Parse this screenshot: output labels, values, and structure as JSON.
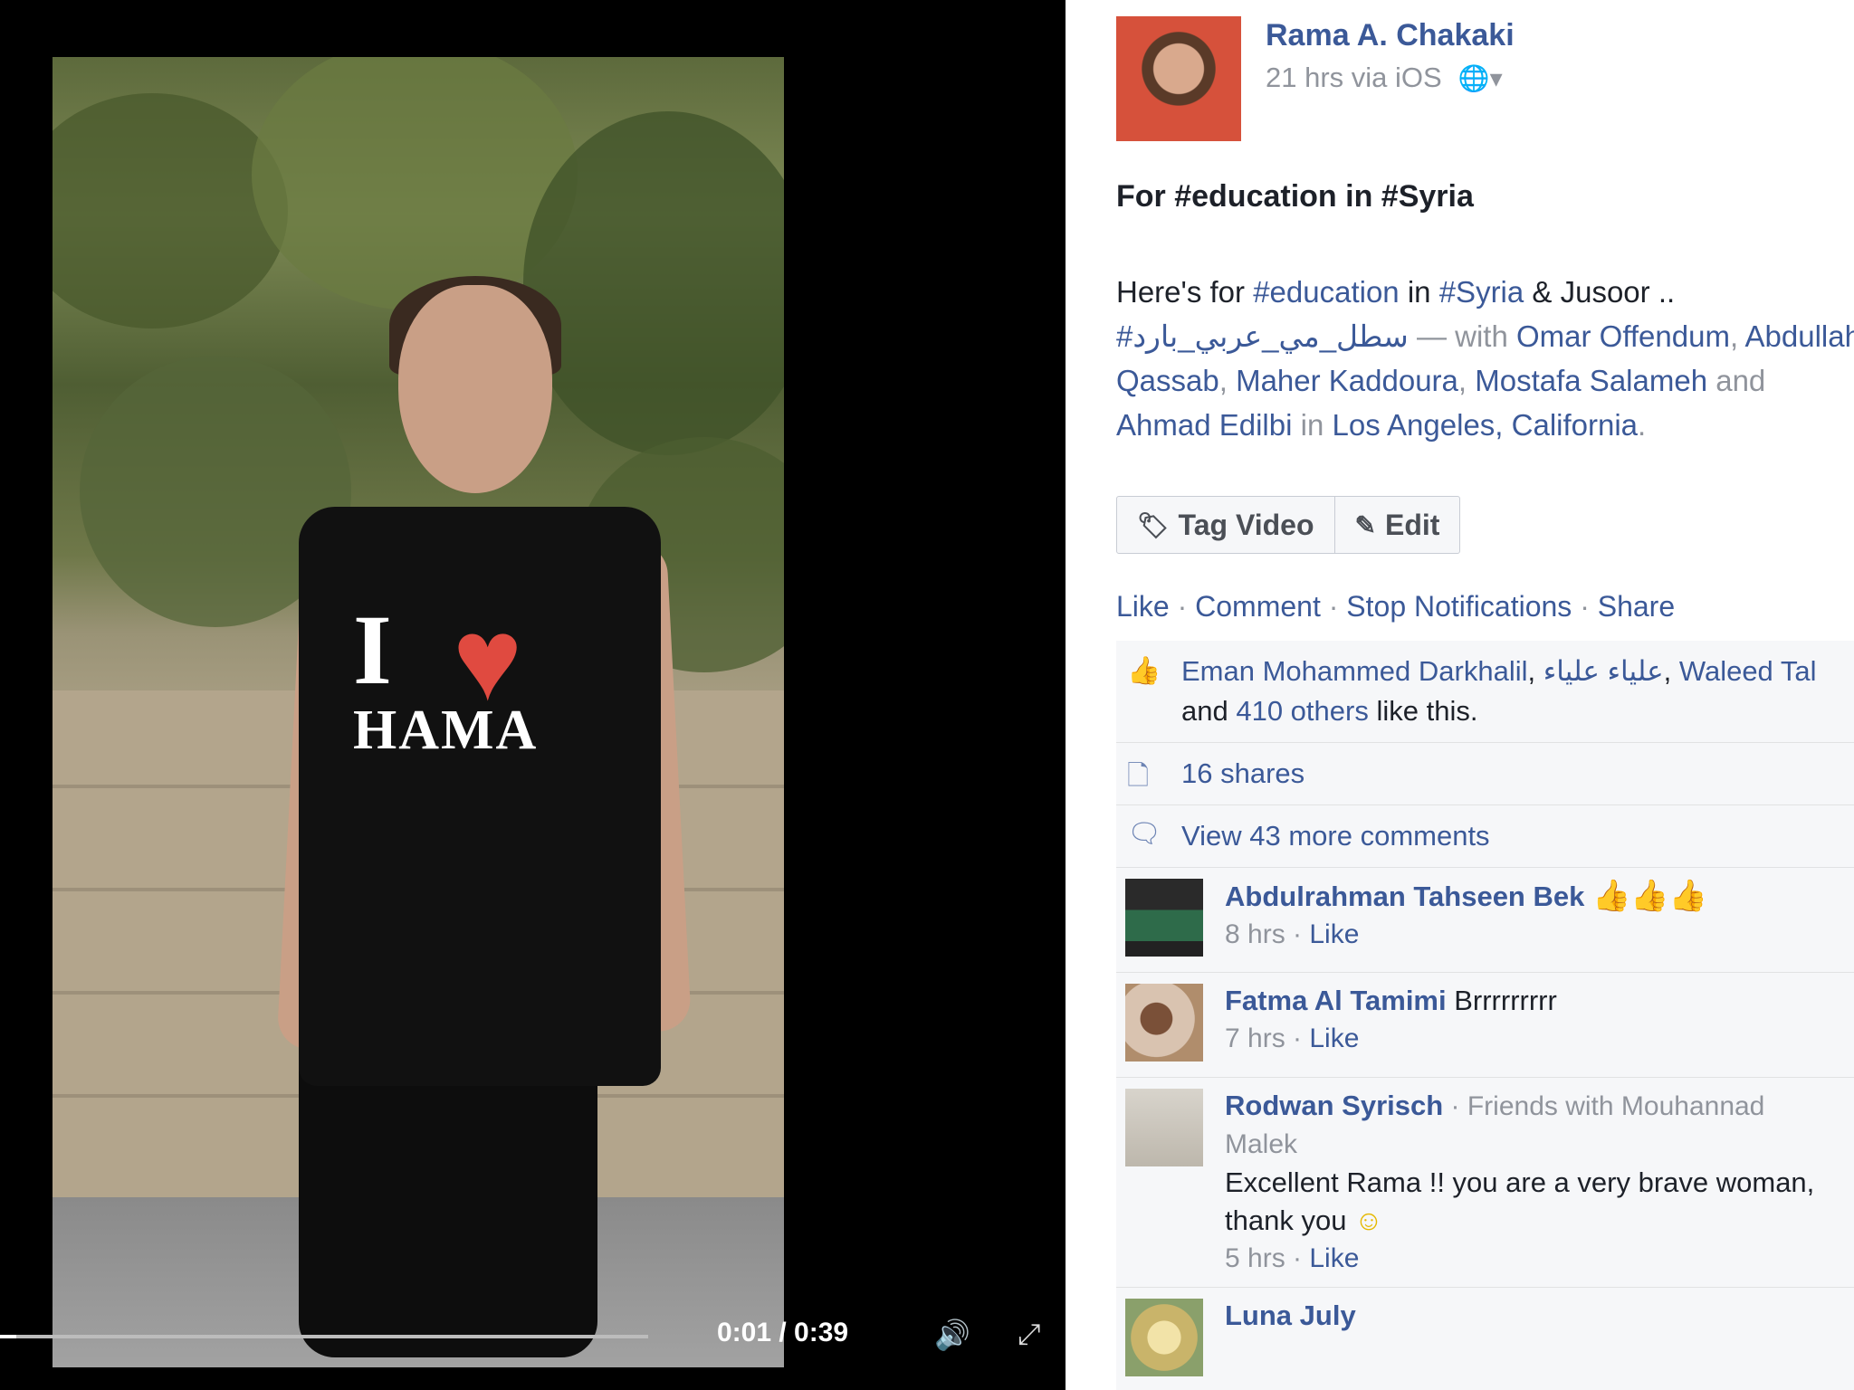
{
  "video": {
    "time": "0:01 / 0:39",
    "progress": 0.025,
    "shirt_line1": "I",
    "shirt_heart": "♥",
    "shirt_line2": "HAMA"
  },
  "post": {
    "author": "Rama A. Chakaki",
    "meta": "21 hrs via iOS",
    "title": "For #education in #Syria",
    "body": {
      "l1_a": "Here's for ",
      "l1_b": "#education",
      "l1_c": " in ",
      "l1_d": "#Syria",
      "l1_e": " & Jusoor ..",
      "l2_a": "#سطل_مي_عربي_بارد",
      "l2_b": " — with ",
      "l2_c": "Omar Offendum",
      "l2_d": ", ",
      "l2_e": "Abdullah",
      "l3_a": "Qassab",
      "l3_b": ", ",
      "l3_c": "Maher Kaddoura",
      "l3_d": ", ",
      "l3_e": "Mostafa Salameh",
      "l3_f": " and",
      "l4_a": "Ahmad Edilbi",
      "l4_b": " in ",
      "l4_c": "Los Angeles, California",
      "l4_d": "."
    },
    "buttons": {
      "tag_video": "Tag Video",
      "edit": "Edit"
    },
    "links": {
      "like": "Like",
      "comment": "Comment",
      "stop_notifications": "Stop Notifications",
      "share": "Share",
      "sep": " · "
    },
    "likes": {
      "names_a": "Eman Mohammed Darkhalil",
      "comma1": ", ",
      "names_b": "علياء علياء",
      "comma2": ", ",
      "names_c": "Waleed Tal",
      "and": "and ",
      "others": "410 others",
      "like_this": " like this."
    },
    "shares": "16 shares",
    "view_more": "View 43 more comments",
    "comments": [
      {
        "name": "Abdulrahman Tahseen Bek",
        "text": "",
        "time": "8 hrs",
        "like": "Like"
      },
      {
        "name": "Fatma Al Tamimi",
        "text": "Brrrrrrrrr",
        "time": "7 hrs",
        "like": "Like"
      },
      {
        "name": "Rodwan Syrisch",
        "friends": " · Friends with Mouhannad",
        "friends2": "Malek",
        "text": "Excellent Rama !! you are a very brave woman,",
        "text2": "thank you",
        "time": "5 hrs",
        "like": "Like"
      },
      {
        "name": "Luna July",
        "text": ""
      }
    ],
    "meta_sep": " · "
  }
}
